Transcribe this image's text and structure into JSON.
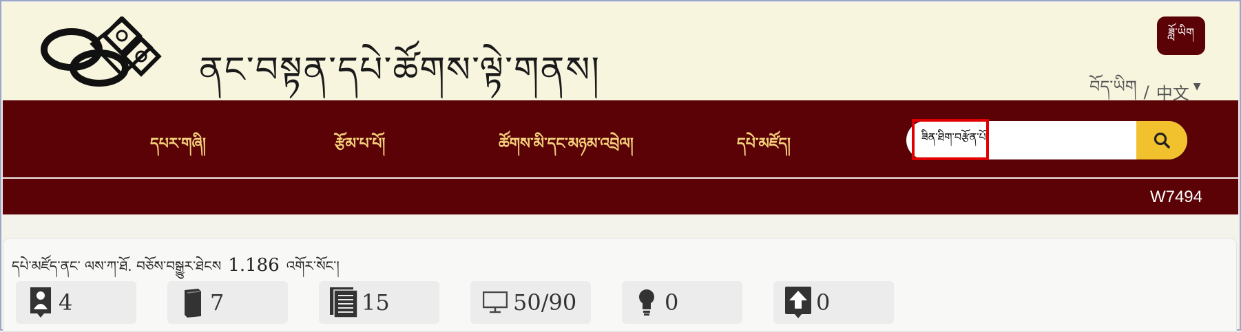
{
  "header": {
    "site_title": "ནང་བསྟན་དཔེ་ཚོགས་ལྟེ་གནས།",
    "script_toggle_label": "ཟློ་ཡིག",
    "lang_tibetan": "བོད་ཡིག",
    "lang_separator": "/",
    "lang_chinese": "中文"
  },
  "nav": {
    "items": [
      {
        "label": "དཔར་གཞི།"
      },
      {
        "label": "རྩོམ་པ་པོ།"
      },
      {
        "label": "ཚོགས་མི་དང་མཉམ་འབྲེལ།"
      },
      {
        "label": "དཔེ་མཛོད།"
      }
    ],
    "search": {
      "value": "ཟིན་ཐིག་བརྩོན་པོ"
    }
  },
  "subbar": {
    "work_id": "W7494"
  },
  "content": {
    "meta_prefix": "དཔེ་མཛོད་ནང་ ལས་ཀ་ཐོ.  བཅོས་བསྒྱུར་ཐེངས",
    "meta_version": "1.186",
    "meta_suffix": "འགོར་སོང་།",
    "stats": [
      {
        "icon": "person-icon",
        "value": "4"
      },
      {
        "icon": "book-icon",
        "value": "7"
      },
      {
        "icon": "volumes-icon",
        "value": "15"
      },
      {
        "icon": "monitor-icon",
        "value": "50/90"
      },
      {
        "icon": "lightbulb-icon",
        "value": "0"
      },
      {
        "icon": "upload-icon",
        "value": "0"
      }
    ]
  },
  "colors": {
    "header_bg": "#f7f5de",
    "nav_bg": "#5a0206",
    "nav_text": "#f3d07a",
    "search_button": "#f2c12e",
    "highlight": "#e00000"
  }
}
